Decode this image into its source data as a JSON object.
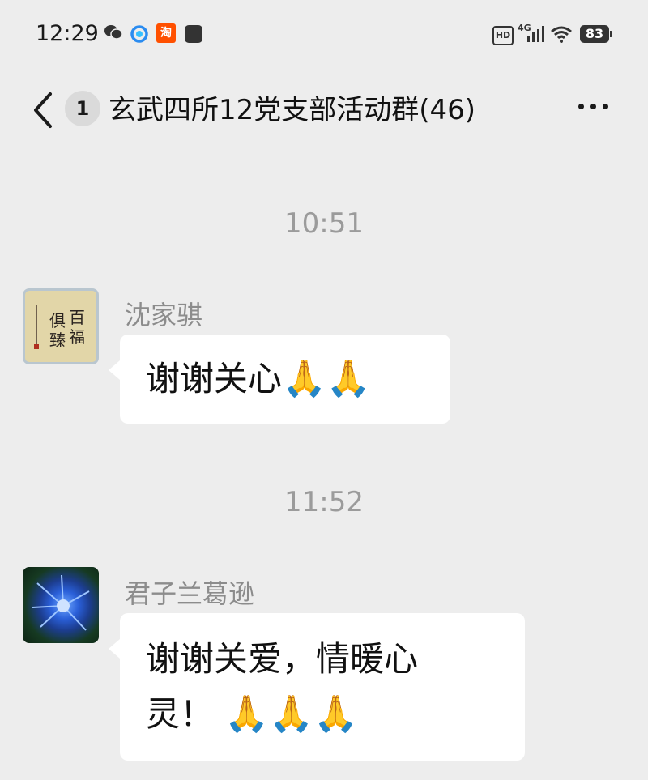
{
  "status_bar": {
    "time": "12:29",
    "hd_label": "HD",
    "network_label": "4G",
    "battery_level": "83",
    "icons": [
      "wechat-icon",
      "qq-browser-icon",
      "taobao-icon",
      "shopping-bag-icon",
      "hd-icon",
      "signal-icon",
      "wifi-icon",
      "battery-icon"
    ]
  },
  "nav": {
    "unread_count": "1",
    "title": "玄武四所12党支部活动群(46)",
    "back_icon": "chevron-left-icon",
    "more_icon": "more-dots-icon"
  },
  "messages": [
    {
      "time_divider": "10:51",
      "sender": "沈家骐",
      "text": "谢谢关心",
      "emoji": "🙏🙏",
      "avatar_text": "百福俱臻"
    },
    {
      "time_divider": "11:52",
      "sender": "君子兰葛逊",
      "text_line1": "谢谢关爱，情暖心",
      "text_line2": "灵！",
      "emoji": "🙏🙏🙏"
    }
  ],
  "colors": {
    "background": "#ededed",
    "bubble": "#ffffff",
    "timestamp": "#9b9b9b",
    "sender_name": "#8c8c8c"
  }
}
